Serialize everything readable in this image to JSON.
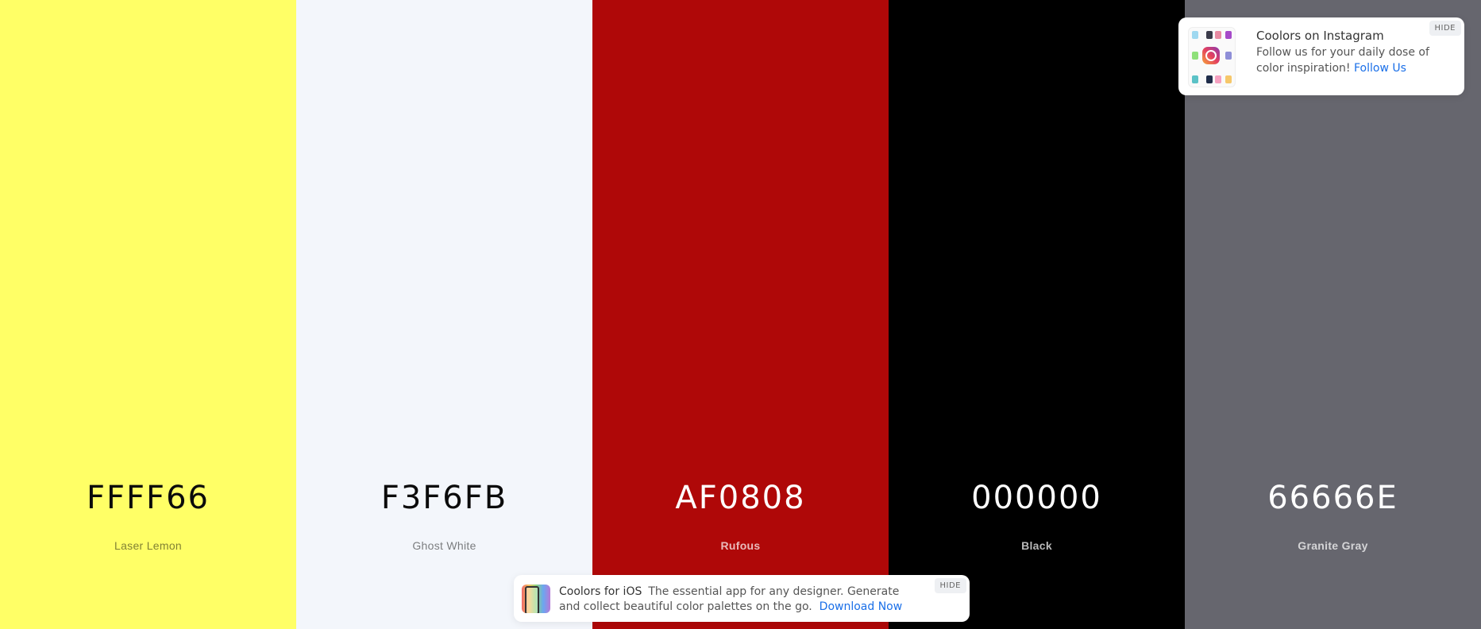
{
  "palette": {
    "colors": [
      {
        "hex": "FFFF66",
        "name": "Laser Lemon",
        "color": "#FFFF66",
        "tone": "light"
      },
      {
        "hex": "F3F6FB",
        "name": "Ghost White",
        "color": "#F3F6FB",
        "tone": "light"
      },
      {
        "hex": "AF0808",
        "name": "Rufous",
        "color": "#AF0808",
        "tone": "dark"
      },
      {
        "hex": "000000",
        "name": "Black",
        "color": "#000000",
        "tone": "dark"
      },
      {
        "hex": "66666E",
        "name": "Granite Gray",
        "color": "#66666E",
        "tone": "dark"
      }
    ]
  },
  "instagram_notice": {
    "title": "Coolors on Instagram",
    "body": "Follow us for your daily dose of color inspiration!",
    "link": "Follow Us",
    "hide_label": "HIDE",
    "icon": "instagram-icon"
  },
  "ios_notice": {
    "title": "Coolors for iOS",
    "body": "The essential app for any designer. Generate and collect beautiful color palettes on the go.",
    "link": "Download Now",
    "hide_label": "HIDE",
    "icon": "phone-app-icon"
  },
  "accent_colors": {
    "link": "#1a6fe8"
  }
}
